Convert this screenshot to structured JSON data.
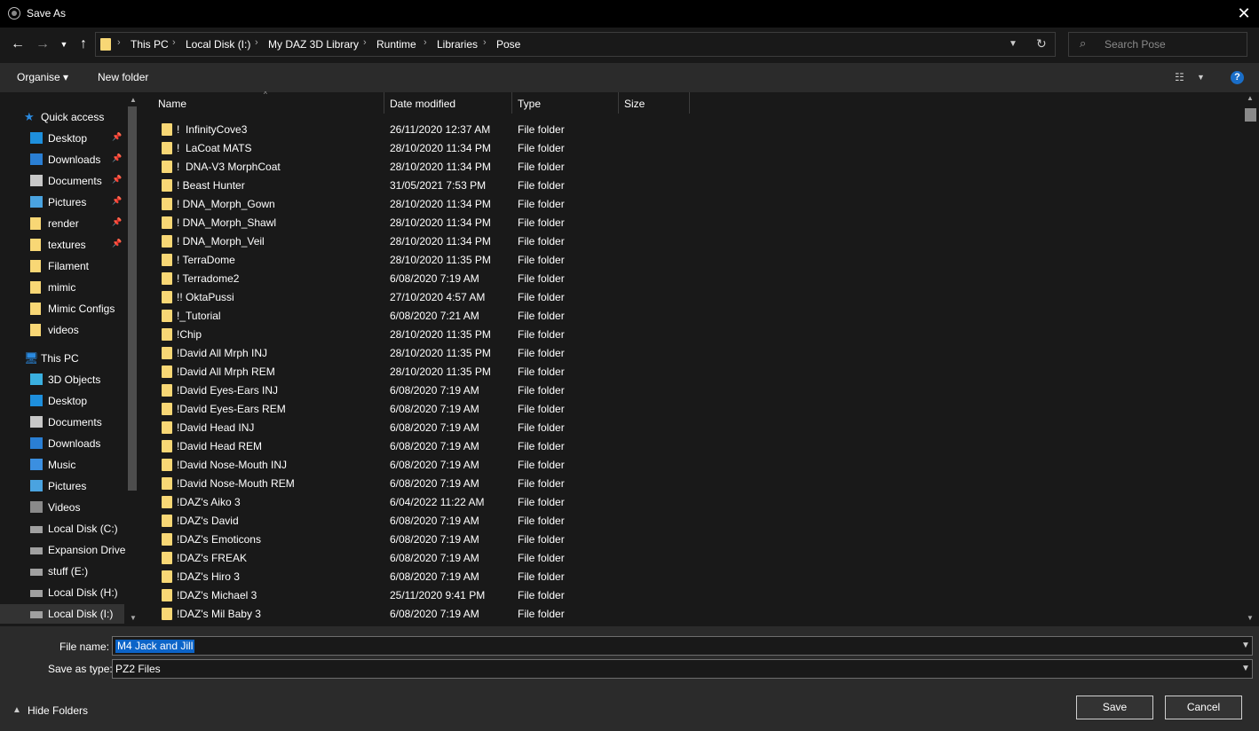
{
  "window": {
    "title": "Save As"
  },
  "address": {
    "crumbs": [
      "This PC",
      "Local Disk (I:)",
      "My DAZ 3D Library",
      "Runtime",
      "Libraries",
      "Pose"
    ]
  },
  "search": {
    "placeholder": "Search Pose"
  },
  "toolbar": {
    "organise": "Organise ▾",
    "new_folder": "New folder",
    "help": "?"
  },
  "nav": {
    "quick_access": "Quick access",
    "quick_items": [
      {
        "label": "Desktop",
        "icon": "desktop-icon",
        "pinned": true
      },
      {
        "label": "Downloads",
        "icon": "downloads-icon",
        "pinned": true
      },
      {
        "label": "Documents",
        "icon": "documents-icon",
        "pinned": true
      },
      {
        "label": "Pictures",
        "icon": "pictures-icon",
        "pinned": true
      },
      {
        "label": "render",
        "icon": "folder-icon",
        "pinned": true
      },
      {
        "label": "textures",
        "icon": "folder-icon",
        "pinned": true
      },
      {
        "label": "Filament",
        "icon": "folder-icon",
        "pinned": false
      },
      {
        "label": "mimic",
        "icon": "folder-icon",
        "pinned": false
      },
      {
        "label": "Mimic Configs",
        "icon": "folder-icon",
        "pinned": false
      },
      {
        "label": "videos",
        "icon": "folder-icon",
        "pinned": false
      }
    ],
    "this_pc": "This PC",
    "pc_items": [
      {
        "label": "3D Objects",
        "icon": "3d-objects-icon"
      },
      {
        "label": "Desktop",
        "icon": "desktop-icon"
      },
      {
        "label": "Documents",
        "icon": "documents-icon"
      },
      {
        "label": "Downloads",
        "icon": "downloads-icon"
      },
      {
        "label": "Music",
        "icon": "music-icon"
      },
      {
        "label": "Pictures",
        "icon": "pictures-icon"
      },
      {
        "label": "Videos",
        "icon": "videos-icon"
      },
      {
        "label": "Local Disk (C:)",
        "icon": "drive-icon"
      },
      {
        "label": "Expansion Drive",
        "icon": "drive-icon"
      },
      {
        "label": "stuff (E:)",
        "icon": "drive-icon"
      },
      {
        "label": "Local Disk (H:)",
        "icon": "drive-icon"
      },
      {
        "label": "Local Disk (I:)",
        "icon": "drive-icon"
      }
    ]
  },
  "columns": {
    "name": "Name",
    "date": "Date modified",
    "type": "Type",
    "size": "Size"
  },
  "files": [
    {
      "name": "!  InfinityCove3",
      "date": "26/11/2020 12:37 AM",
      "type": "File folder"
    },
    {
      "name": "!  LaCoat MATS",
      "date": "28/10/2020 11:34 PM",
      "type": "File folder"
    },
    {
      "name": "!  DNA-V3 MorphCoat",
      "date": "28/10/2020 11:34 PM",
      "type": "File folder"
    },
    {
      "name": "! Beast Hunter",
      "date": "31/05/2021 7:53 PM",
      "type": "File folder"
    },
    {
      "name": "! DNA_Morph_Gown",
      "date": "28/10/2020 11:34 PM",
      "type": "File folder"
    },
    {
      "name": "! DNA_Morph_Shawl",
      "date": "28/10/2020 11:34 PM",
      "type": "File folder"
    },
    {
      "name": "! DNA_Morph_Veil",
      "date": "28/10/2020 11:34 PM",
      "type": "File folder"
    },
    {
      "name": "! TerraDome",
      "date": "28/10/2020 11:35 PM",
      "type": "File folder"
    },
    {
      "name": "! Terradome2",
      "date": "6/08/2020 7:19 AM",
      "type": "File folder"
    },
    {
      "name": "!! OktaPussi",
      "date": "27/10/2020 4:57 AM",
      "type": "File folder"
    },
    {
      "name": "!_Tutorial",
      "date": "6/08/2020 7:21 AM",
      "type": "File folder"
    },
    {
      "name": "!Chip",
      "date": "28/10/2020 11:35 PM",
      "type": "File folder"
    },
    {
      "name": "!David All Mrph INJ",
      "date": "28/10/2020 11:35 PM",
      "type": "File folder"
    },
    {
      "name": "!David All Mrph REM",
      "date": "28/10/2020 11:35 PM",
      "type": "File folder"
    },
    {
      "name": "!David Eyes-Ears INJ",
      "date": "6/08/2020 7:19 AM",
      "type": "File folder"
    },
    {
      "name": "!David Eyes-Ears REM",
      "date": "6/08/2020 7:19 AM",
      "type": "File folder"
    },
    {
      "name": "!David Head INJ",
      "date": "6/08/2020 7:19 AM",
      "type": "File folder"
    },
    {
      "name": "!David Head REM",
      "date": "6/08/2020 7:19 AM",
      "type": "File folder"
    },
    {
      "name": "!David Nose-Mouth INJ",
      "date": "6/08/2020 7:19 AM",
      "type": "File folder"
    },
    {
      "name": "!David Nose-Mouth REM",
      "date": "6/08/2020 7:19 AM",
      "type": "File folder"
    },
    {
      "name": "!DAZ's Aiko 3",
      "date": "6/04/2022 11:22 AM",
      "type": "File folder"
    },
    {
      "name": "!DAZ's David",
      "date": "6/08/2020 7:19 AM",
      "type": "File folder"
    },
    {
      "name": "!DAZ's Emoticons",
      "date": "6/08/2020 7:19 AM",
      "type": "File folder"
    },
    {
      "name": "!DAZ's FREAK",
      "date": "6/08/2020 7:19 AM",
      "type": "File folder"
    },
    {
      "name": "!DAZ's Hiro 3",
      "date": "6/08/2020 7:19 AM",
      "type": "File folder"
    },
    {
      "name": "!DAZ's Michael 3",
      "date": "25/11/2020 9:41 PM",
      "type": "File folder"
    },
    {
      "name": "!DAZ's Mil Baby 3",
      "date": "6/08/2020 7:19 AM",
      "type": "File folder"
    }
  ],
  "form": {
    "file_name_label": "File name:",
    "file_name_value": "M4 Jack and Jill",
    "save_type_label": "Save as type:",
    "save_type_value": "PZ2 Files"
  },
  "footer": {
    "hide_folders": "Hide Folders",
    "save": "Save",
    "cancel": "Cancel"
  },
  "colors": {
    "accent": "#0c64c8",
    "folder": "#f8d775",
    "background": "#191919",
    "panel": "#2b2b2b"
  }
}
